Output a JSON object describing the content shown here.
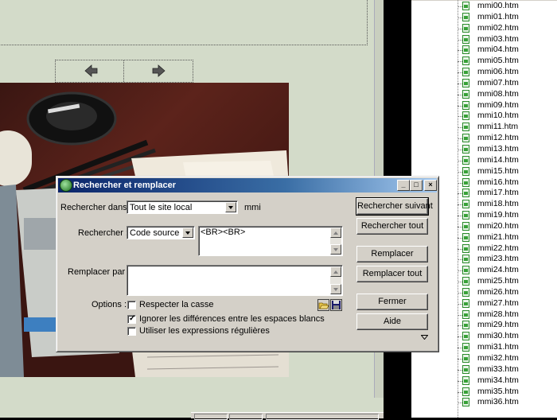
{
  "dialog": {
    "title": "Rechercher et remplacer",
    "search_in_label": "Rechercher dans :",
    "search_in_value": "Tout le site local",
    "site_name": "mmi",
    "search_label": "Rechercher :",
    "search_type_value": "Code source",
    "search_text": "<BR><BR>",
    "replace_label": "Remplacer par :",
    "replace_text": "",
    "options_label": "Options :",
    "options": [
      {
        "label": "Respecter la casse",
        "checked": false
      },
      {
        "label": "Ignorer les différences entre les espaces blancs",
        "checked": true
      },
      {
        "label": "Utiliser les expressions régulières",
        "checked": false
      }
    ],
    "buttons": {
      "find_next": "Rechercher suivant",
      "find_all": "Rechercher tout",
      "replace": "Remplacer",
      "replace_all": "Remplacer tout",
      "close": "Fermer",
      "help": "Aide"
    },
    "window_controls": {
      "minimize": "_",
      "maximize": "□",
      "close": "×"
    },
    "icons": {
      "title": "dreamweaver-icon",
      "open": "open-folder-icon",
      "save": "save-disk-icon",
      "expand": "expand-arrow-icon"
    }
  },
  "file_panel": {
    "files": [
      "mmi00.htm",
      "mmi01.htm",
      "mmi02.htm",
      "mmi03.htm",
      "mmi04.htm",
      "mmi05.htm",
      "mmi06.htm",
      "mmi07.htm",
      "mmi08.htm",
      "mmi09.htm",
      "mmi10.htm",
      "mmi11.htm",
      "mmi12.htm",
      "mmi13.htm",
      "mmi14.htm",
      "mmi15.htm",
      "mmi16.htm",
      "mmi17.htm",
      "mmi18.htm",
      "mmi19.htm",
      "mmi20.htm",
      "mmi21.htm",
      "mmi22.htm",
      "mmi23.htm",
      "mmi24.htm",
      "mmi25.htm",
      "mmi26.htm",
      "mmi27.htm",
      "mmi28.htm",
      "mmi29.htm",
      "mmi30.htm",
      "mmi31.htm",
      "mmi32.htm",
      "mmi33.htm",
      "mmi34.htm",
      "mmi35.htm",
      "mmi36.htm"
    ],
    "file_icon": "html-file-icon"
  },
  "canvas": {
    "nav_icons": [
      "arrow-left-icon",
      "arrow-right-icon"
    ],
    "background_color": "#d3dbc9"
  },
  "colors": {
    "titlebar_start": "#0a246a",
    "titlebar_end": "#a6caf0",
    "dialog_face": "#d4d0c8"
  }
}
